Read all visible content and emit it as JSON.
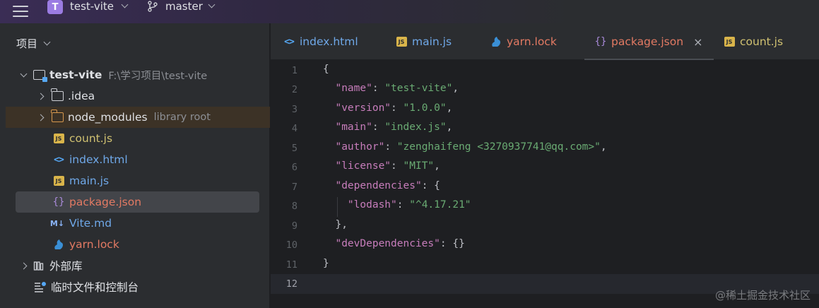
{
  "titlebar": {
    "project_badge": "T",
    "project_name": "test-vite",
    "branch": "master"
  },
  "sidebar": {
    "header": "项目",
    "tree": [
      {
        "label": "test-vite",
        "hint": "F:\\学习项目\\test-vite",
        "icon": "project-folder-icon",
        "expanded": true
      },
      {
        "label": ".idea",
        "icon": "folder-icon",
        "expanded": false
      },
      {
        "label": "node_modules",
        "hint": "library root",
        "icon": "folder-icon",
        "expanded": false
      },
      {
        "label": "count.js",
        "icon": "js-file-icon"
      },
      {
        "label": "index.html",
        "icon": "html-file-icon"
      },
      {
        "label": "main.js",
        "icon": "js-file-icon"
      },
      {
        "label": "package.json",
        "icon": "json-file-icon",
        "selected": true
      },
      {
        "label": "Vite.md",
        "icon": "markdown-file-icon"
      },
      {
        "label": "yarn.lock",
        "icon": "yarn-file-icon"
      },
      {
        "label": "外部库",
        "icon": "library-icon",
        "expanded": false
      },
      {
        "label": "临时文件和控制台",
        "icon": "scratches-icon"
      }
    ]
  },
  "tabs": [
    {
      "label": "index.html",
      "icon": "html-file-icon"
    },
    {
      "label": "main.js",
      "icon": "js-file-icon"
    },
    {
      "label": "yarn.lock",
      "icon": "yarn-file-icon"
    },
    {
      "label": "package.json",
      "icon": "json-file-icon",
      "active": true,
      "close": "×"
    },
    {
      "label": "count.js",
      "icon": "js-file-icon"
    }
  ],
  "editor": {
    "line_numbers": [
      "1",
      "2",
      "3",
      "4",
      "5",
      "6",
      "7",
      "8",
      "9",
      "10",
      "11",
      "12"
    ],
    "current_line": 12,
    "lines": {
      "l1": "{",
      "l2k": "\"name\"",
      "l2v": "\"test-vite\"",
      "l3k": "\"version\"",
      "l3v": "\"1.0.0\"",
      "l4k": "\"main\"",
      "l4v": "\"index.js\"",
      "l5k": "\"author\"",
      "l5v": "\"zenghaifeng <3270937741@qq.com>\"",
      "l6k": "\"license\"",
      "l6v": "\"MIT\"",
      "l7k": "\"dependencies\"",
      "l7v": "{",
      "l8k": "\"lodash\"",
      "l8v": "\"^4.17.21\"",
      "l9": "},",
      "l10k": "\"devDependencies\"",
      "l10v": "{}",
      "l11": "}"
    }
  },
  "watermark": "@稀土掘金技术社区",
  "colors": {
    "background": "#1e1f22",
    "panel": "#2b2d30",
    "json_key": "#c77dbb",
    "json_string": "#6aab73",
    "modified_file": "#e37a63"
  }
}
